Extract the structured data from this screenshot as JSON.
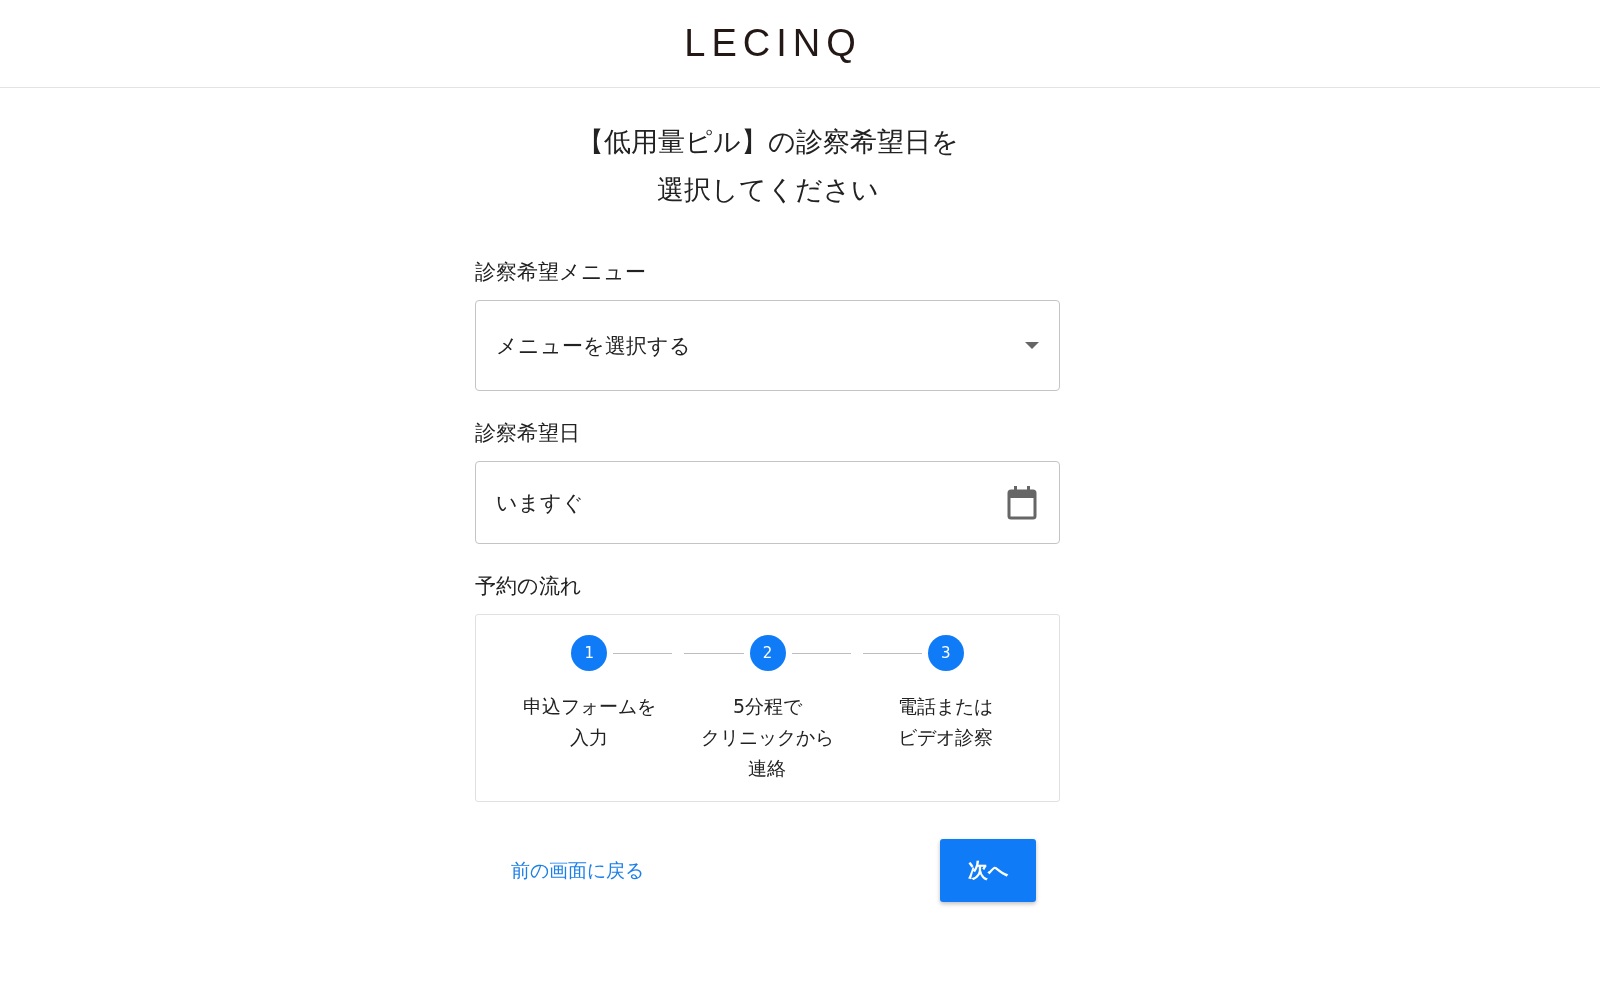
{
  "header": {
    "logo": "LECINQ"
  },
  "title": [
    "【低用量ピル】の診察希望日を",
    "選択してください"
  ],
  "fields": [
    {
      "kind": "select",
      "label": "診察希望メニュー",
      "placeholder": "メニューを選択する"
    },
    {
      "kind": "date",
      "label": "診察希望日",
      "value": "いますぐ"
    }
  ],
  "flow": {
    "label": "予約の流れ",
    "steps": [
      {
        "number": "1",
        "lines": [
          "申込フォームを",
          "入力"
        ]
      },
      {
        "number": "2",
        "lines": [
          "5分程で",
          "クリニックから",
          "連絡"
        ]
      },
      {
        "number": "3",
        "lines": [
          "電話または",
          "ビデオ診察"
        ]
      }
    ]
  },
  "actions": {
    "back": "前の画面に戻る",
    "next": "次へ"
  }
}
